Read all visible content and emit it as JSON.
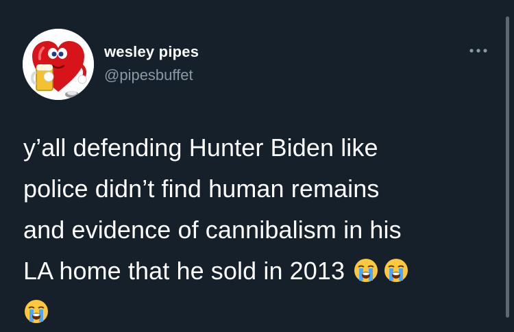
{
  "user": {
    "display_name": "wesley pipes",
    "handle": "@pipesbuffet",
    "avatar_icon": "heart-mascot-with-beer-avatar"
  },
  "menu": {
    "more_icon": "more-horizontal-icon"
  },
  "tweet": {
    "lines": [
      "y’all defending Hunter Biden like",
      "police didn’t find human remains",
      "and evidence of cannibalism in his",
      "LA home that he sold in 2013"
    ],
    "emoji": "loudly-crying-face-emoji"
  },
  "colors": {
    "background": "#15202b",
    "primary_text": "#ffffff",
    "secondary_text": "#8b98a5"
  }
}
